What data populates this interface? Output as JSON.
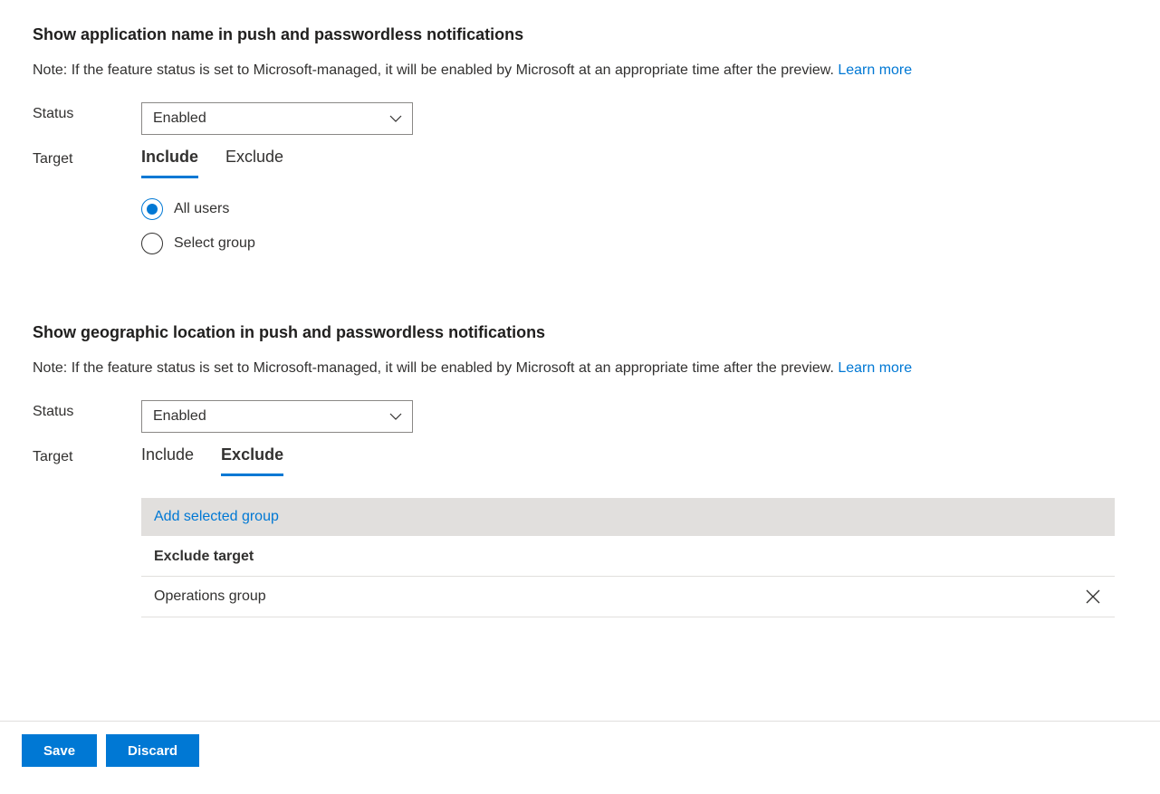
{
  "section1": {
    "title": "Show application name in push and passwordless notifications",
    "note": "Note: If the feature status is set to Microsoft-managed, it will be enabled by Microsoft at an appropriate time after the preview. ",
    "learn_more": "Learn more",
    "status_label": "Status",
    "status_value": "Enabled",
    "target_label": "Target",
    "tabs": {
      "include": "Include",
      "exclude": "Exclude"
    },
    "radios": {
      "all_users": "All users",
      "select_group": "Select group"
    }
  },
  "section2": {
    "title": "Show geographic location in push and passwordless notifications",
    "note": "Note: If the feature status is set to Microsoft-managed, it will be enabled by Microsoft at an appropriate time after the preview. ",
    "learn_more": "Learn more",
    "status_label": "Status",
    "status_value": "Enabled",
    "target_label": "Target",
    "tabs": {
      "include": "Include",
      "exclude": "Exclude"
    },
    "add_group": "Add selected group",
    "exclude_header": "Exclude target",
    "exclude_items": [
      {
        "name": "Operations group"
      }
    ]
  },
  "footer": {
    "save": "Save",
    "discard": "Discard"
  }
}
